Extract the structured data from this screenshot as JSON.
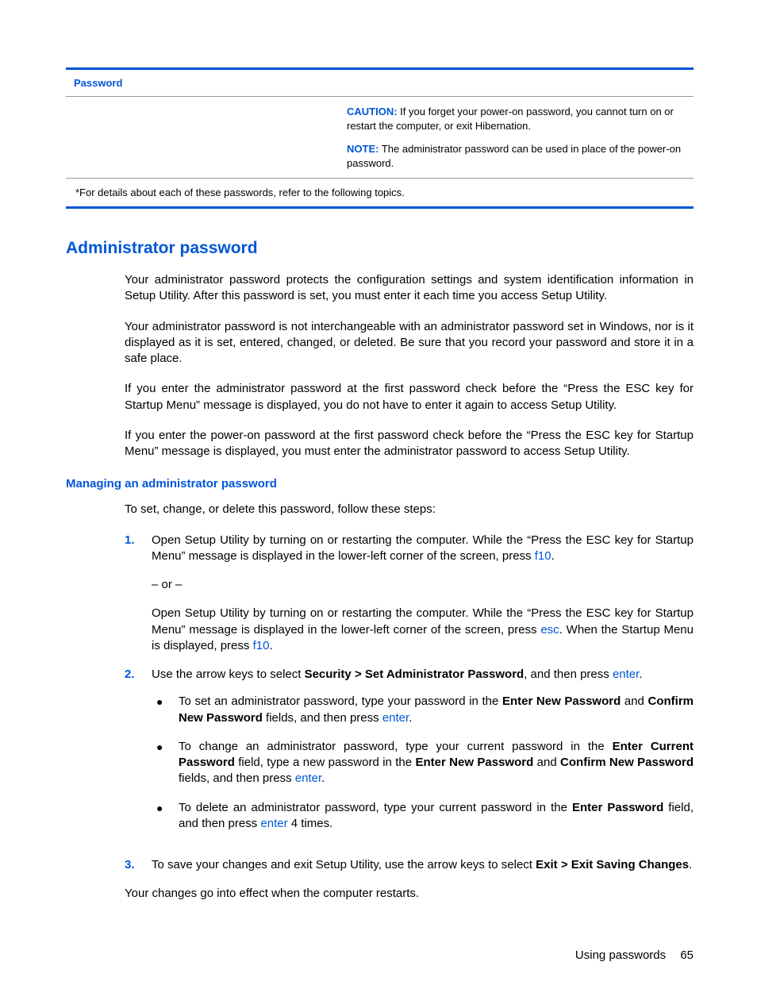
{
  "table": {
    "header_col1": "Password",
    "caution_label": "CAUTION:",
    "caution_text": "If you forget your power-on password, you cannot turn on or restart the computer, or exit Hibernation.",
    "note_label": "NOTE:",
    "note_text": "The administrator password can be used in place of the power-on password.",
    "footnote": "*For details about each of these passwords, refer to the following topics."
  },
  "h2": "Administrator password",
  "para1": "Your administrator password protects the configuration settings and system identification information in Setup Utility. After this password is set, you must enter it each time you access Setup Utility.",
  "para2": "Your administrator password is not interchangeable with an administrator password set in Windows, nor is it displayed as it is set, entered, changed, or deleted. Be sure that you record your password and store it in a safe place.",
  "para3": "If you enter the administrator password at the first password check before the “Press the ESC key for Startup Menu” message is displayed, you do not have to enter it again to access Setup Utility.",
  "para4": "If you enter the power-on password at the first password check before the “Press the ESC key for Startup Menu” message is displayed, you must enter the administrator password to access Setup Utility.",
  "h3": "Managing an administrator password",
  "intro": "To set, change, or delete this password, follow these steps:",
  "step1": {
    "num": "1.",
    "text_a": "Open Setup Utility by turning on or restarting the computer. While the “Press the ESC key for Startup Menu” message is displayed in the lower-left corner of the screen, press ",
    "key1": "f10",
    "text_b": ".",
    "or": "– or –",
    "text_c": "Open Setup Utility by turning on or restarting the computer. While the “Press the ESC key for Startup Menu” message is displayed in the lower-left corner of the screen, press ",
    "key2": "esc",
    "text_d": ". When the Startup Menu is displayed, press ",
    "key3": "f10",
    "text_e": "."
  },
  "step2": {
    "num": "2.",
    "text_a": "Use the arrow keys to select ",
    "bold1": "Security > Set Administrator Password",
    "text_b": ", and then press ",
    "key1": "enter",
    "text_c": ".",
    "bullets": [
      {
        "pre": "To set an administrator password, type your password in the ",
        "b1": "Enter New Password",
        "mid1": " and ",
        "b2": "Confirm New Password",
        "mid2": " fields, and then press ",
        "key": "enter",
        "post": "."
      },
      {
        "pre": "To change an administrator password, type your current password in the ",
        "b1": "Enter Current Password",
        "mid1": " field, type a new password in the ",
        "b2": "Enter New Password",
        "mid2": " and ",
        "b3": "Confirm New Password",
        "mid3": " fields, and then press ",
        "key": "enter",
        "post": "."
      },
      {
        "pre": "To delete an administrator password, type your current password in the ",
        "b1": "Enter Password",
        "mid1": " field, and then press ",
        "key": "enter",
        "post": " 4 times."
      }
    ]
  },
  "step3": {
    "num": "3.",
    "text_a": "To save your changes and exit Setup Utility, use the arrow keys to select ",
    "bold1": "Exit > Exit Saving Changes",
    "text_b": "."
  },
  "closing": "Your changes go into effect when the computer restarts.",
  "footer": {
    "label": "Using passwords",
    "page": "65"
  }
}
